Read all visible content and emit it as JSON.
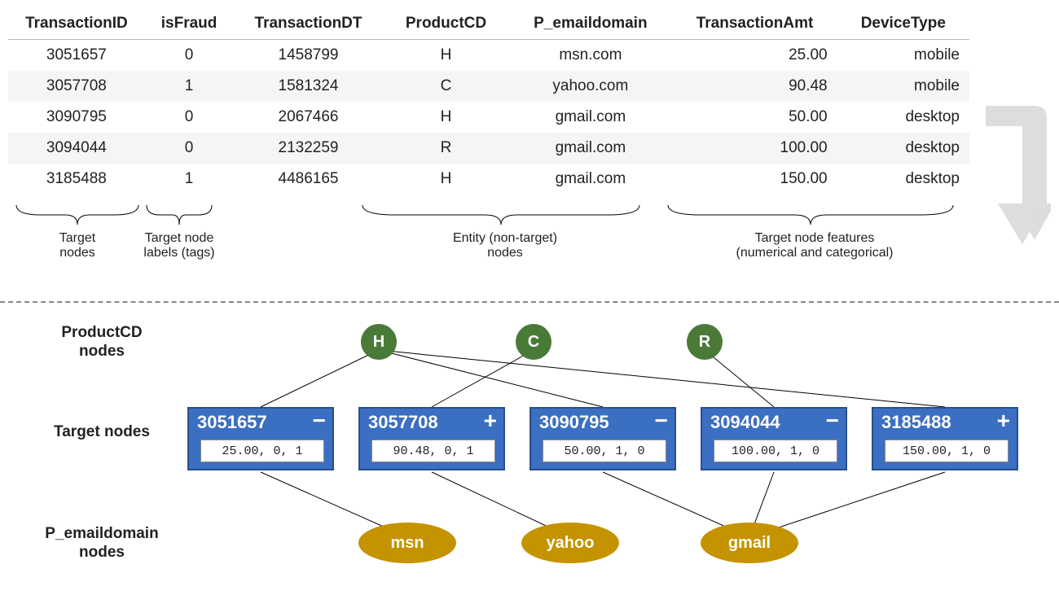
{
  "table": {
    "headers": [
      "TransactionID",
      "isFraud",
      "TransactionDT",
      "ProductCD",
      "P_emaildomain",
      "TransactionAmt",
      "DeviceType"
    ],
    "rows": [
      {
        "TransactionID": "3051657",
        "isFraud": "0",
        "TransactionDT": "1458799",
        "ProductCD": "H",
        "P_emaildomain": "msn.com",
        "TransactionAmt": "25.00",
        "DeviceType": "mobile"
      },
      {
        "TransactionID": "3057708",
        "isFraud": "1",
        "TransactionDT": "1581324",
        "ProductCD": "C",
        "P_emaildomain": "yahoo.com",
        "TransactionAmt": "90.48",
        "DeviceType": "mobile"
      },
      {
        "TransactionID": "3090795",
        "isFraud": "0",
        "TransactionDT": "2067466",
        "ProductCD": "H",
        "P_emaildomain": "gmail.com",
        "TransactionAmt": "50.00",
        "DeviceType": "desktop"
      },
      {
        "TransactionID": "3094044",
        "isFraud": "0",
        "TransactionDT": "2132259",
        "ProductCD": "R",
        "P_emaildomain": "gmail.com",
        "TransactionAmt": "100.00",
        "DeviceType": "desktop"
      },
      {
        "TransactionID": "3185488",
        "isFraud": "1",
        "TransactionDT": "4486165",
        "ProductCD": "H",
        "P_emaildomain": "gmail.com",
        "TransactionAmt": "150.00",
        "DeviceType": "desktop"
      }
    ]
  },
  "annotations": {
    "target_nodes": "Target\nnodes",
    "target_labels": "Target node\nlabels (tags)",
    "entity_nodes": "Entity (non-target)\nnodes",
    "target_features": "Target node features\n(numerical and categorical)"
  },
  "graph": {
    "row_labels": {
      "product": "ProductCD\nnodes",
      "target": "Target nodes",
      "email": "P_emaildomain\nnodes"
    },
    "product_nodes": [
      "H",
      "C",
      "R"
    ],
    "target_nodes": [
      {
        "id": "3051657",
        "sign": "−",
        "features": "25.00, 0, 1"
      },
      {
        "id": "3057708",
        "sign": "+",
        "features": "90.48, 0, 1"
      },
      {
        "id": "3090795",
        "sign": "−",
        "features": "50.00, 1, 0"
      },
      {
        "id": "3094044",
        "sign": "−",
        "features": "100.00, 1, 0"
      },
      {
        "id": "3185488",
        "sign": "+",
        "features": "150.00, 1, 0"
      }
    ],
    "email_nodes": [
      "msn",
      "yahoo",
      "gmail"
    ]
  }
}
